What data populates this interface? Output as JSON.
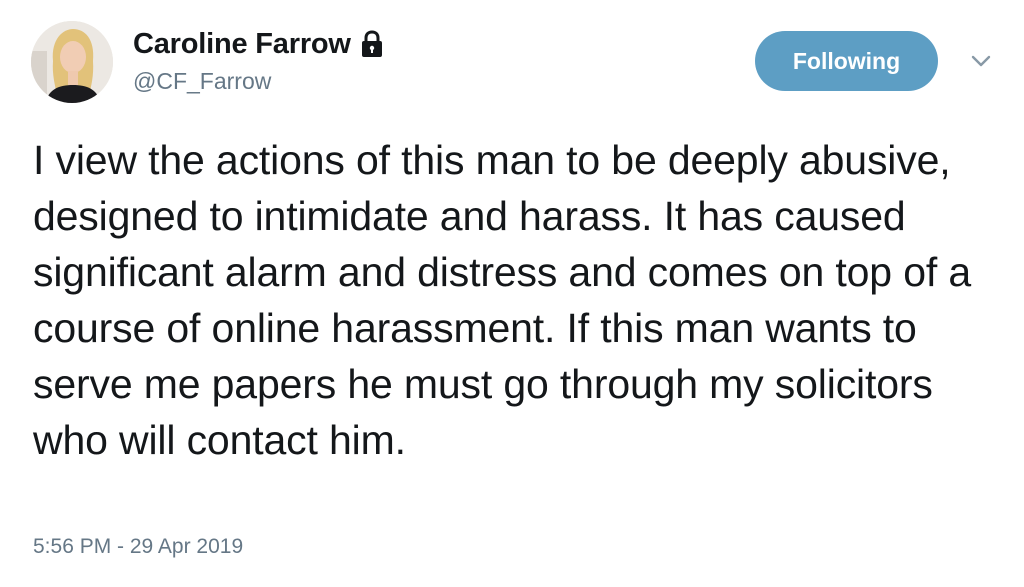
{
  "author": {
    "display_name": "Caroline Farrow",
    "handle": "@CF_Farrow",
    "protected": true,
    "avatar_icon": "profile-photo"
  },
  "actions": {
    "follow_label": "Following",
    "follow_color": "#5d9ec4",
    "more_icon": "chevron-down-icon"
  },
  "tweet": {
    "text": "I view the actions of this man to be deeply abusive, designed to intimidate and harass. It has caused significant alarm and distress and comes on top of a course of online harassment. If this man wants to serve me papers he must go through my solicitors who will contact him.",
    "timestamp": "5:56 PM - 29 Apr 2019"
  }
}
